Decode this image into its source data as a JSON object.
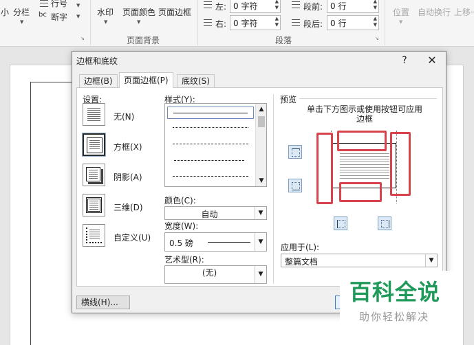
{
  "ribbon": {
    "small_left": "小",
    "columns_label": "分栏",
    "line_numbers_label": "行号",
    "hyphenation_label": "断字",
    "watermark_label": "水印",
    "page_color_label": "页面颜色",
    "page_borders_label": "页面边框",
    "page_background_group": "页面背景",
    "indent_left_label": "左:",
    "indent_left_value": "0 字符",
    "indent_right_label": "右:",
    "indent_right_value": "0 字符",
    "spacing_before_label": "段前:",
    "spacing_before_value": "0 行",
    "spacing_after_label": "段后:",
    "spacing_after_value": "0 行",
    "paragraph_group": "段落",
    "position_label": "位置",
    "wrap_text_label": "自动换行",
    "bring_forward_label": "上移一"
  },
  "dialog": {
    "title": "边框和底纹",
    "help": "?",
    "close": "✕",
    "tabs": [
      {
        "label": "边框(B)"
      },
      {
        "label": "页面边框(P)"
      },
      {
        "label": "底纹(S)"
      }
    ],
    "settings_label": "设置:",
    "settings": [
      {
        "label": "无(N)"
      },
      {
        "label": "方框(X)"
      },
      {
        "label": "阴影(A)"
      },
      {
        "label": "三维(D)"
      },
      {
        "label": "自定义(U)"
      }
    ],
    "style_label": "样式(Y):",
    "color_label": "颜色(C):",
    "color_value": "自动",
    "width_label": "宽度(W):",
    "width_value": "0.5 磅",
    "art_label": "艺术型(R):",
    "art_value": "(无)",
    "preview_label": "预览",
    "preview_hint": "单击下方图示或使用按钮可应用边框",
    "apply_to_label": "应用于(L):",
    "apply_to_value": "整篇文档",
    "horizontal_line_button": "横线(H)..."
  },
  "watermark": {
    "logo": "百科全说",
    "subtitle": "助你轻松解决"
  },
  "colors": {
    "highlight": "#d9434b",
    "watermark_green": "#1f9a5a"
  }
}
